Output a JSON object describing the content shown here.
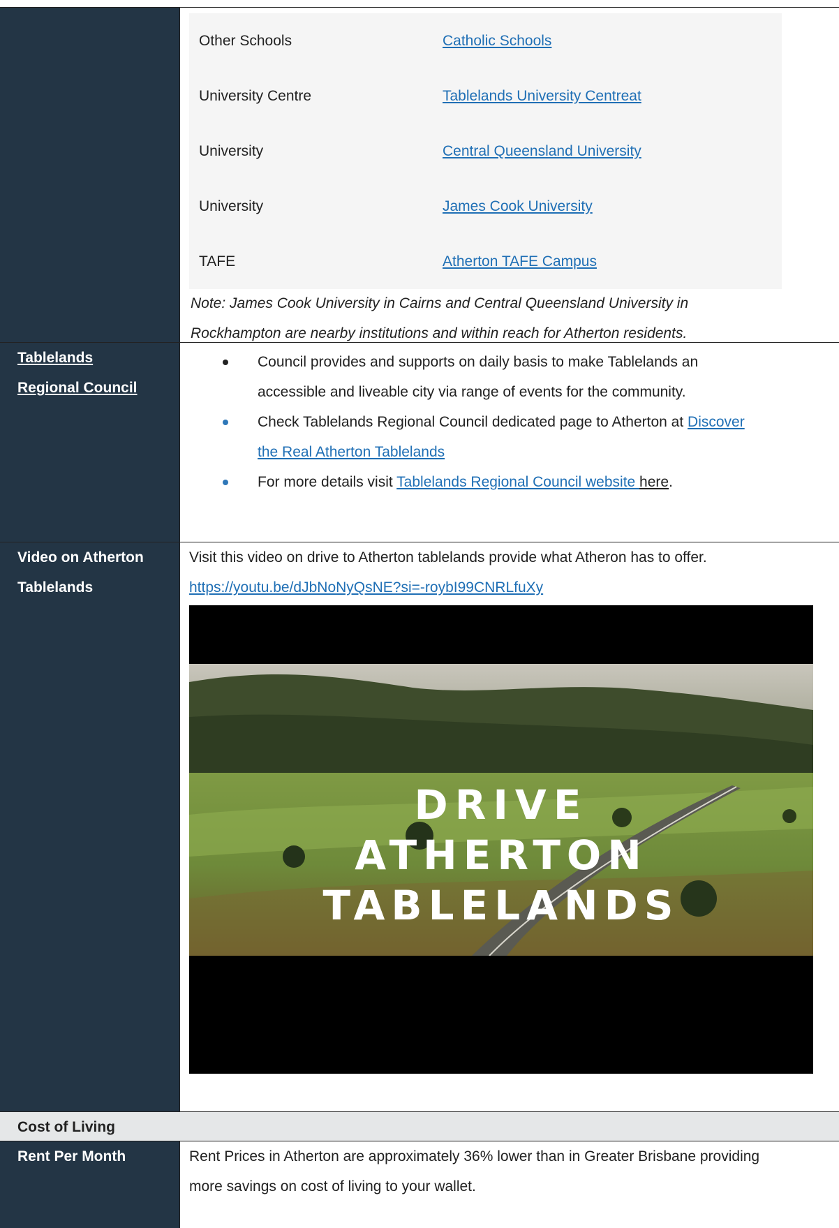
{
  "schools": [
    {
      "type": "Other Schools",
      "link": "Catholic Schools"
    },
    {
      "type": "University Centre",
      "link": "Tablelands University Centreat"
    },
    {
      "type": "University",
      "link": "Central Queensland University"
    },
    {
      "type": "University",
      "link": "James Cook University"
    },
    {
      "type": "TAFE",
      "link": "Atherton TAFE Campus"
    }
  ],
  "note": {
    "line1": "Note: James Cook University in Cairns and Central Queensland University in",
    "line2": "Rockhampton are nearby institutions and within reach for Atherton residents."
  },
  "council": {
    "label_line1": "Tablelands",
    "label_line2": "Regional Council",
    "bullet1_line1": "Council provides and supports on daily basis to make Tablelands an",
    "bullet1_line2": "accessible and liveable city via  range of events for the community.",
    "bullet2_text": "Check Tablelands Regional Council dedicated page to Atherton at ",
    "bullet2_link_line1": "Discover",
    "bullet2_link_line2": "the Real Atherton Tablelands",
    "bullet3_text": "For more details visit ",
    "bullet3_link": "Tablelands Regional Council website ",
    "bullet3_here": "here",
    "bullet3_end": "."
  },
  "video": {
    "label_line1": "Video on Atherton",
    "label_line2": "Tablelands",
    "description": "Visit this video on drive to Atherton tablelands provide what Atheron has to offer.",
    "url": "https://youtu.be/dJbNoNyQsNE?si=-roybI99CNRLfuXy",
    "thumb_line1": "DRIVE",
    "thumb_line2": "ATHERTON TABLELANDS"
  },
  "cost": {
    "heading": "Cost of Living",
    "rent_label": "Rent Per Month",
    "rent_line1": "Rent Prices in Atherton are approximately 36% lower than in Greater Brisbane providing",
    "rent_line2": "more savings on cost of living to your wallet."
  }
}
